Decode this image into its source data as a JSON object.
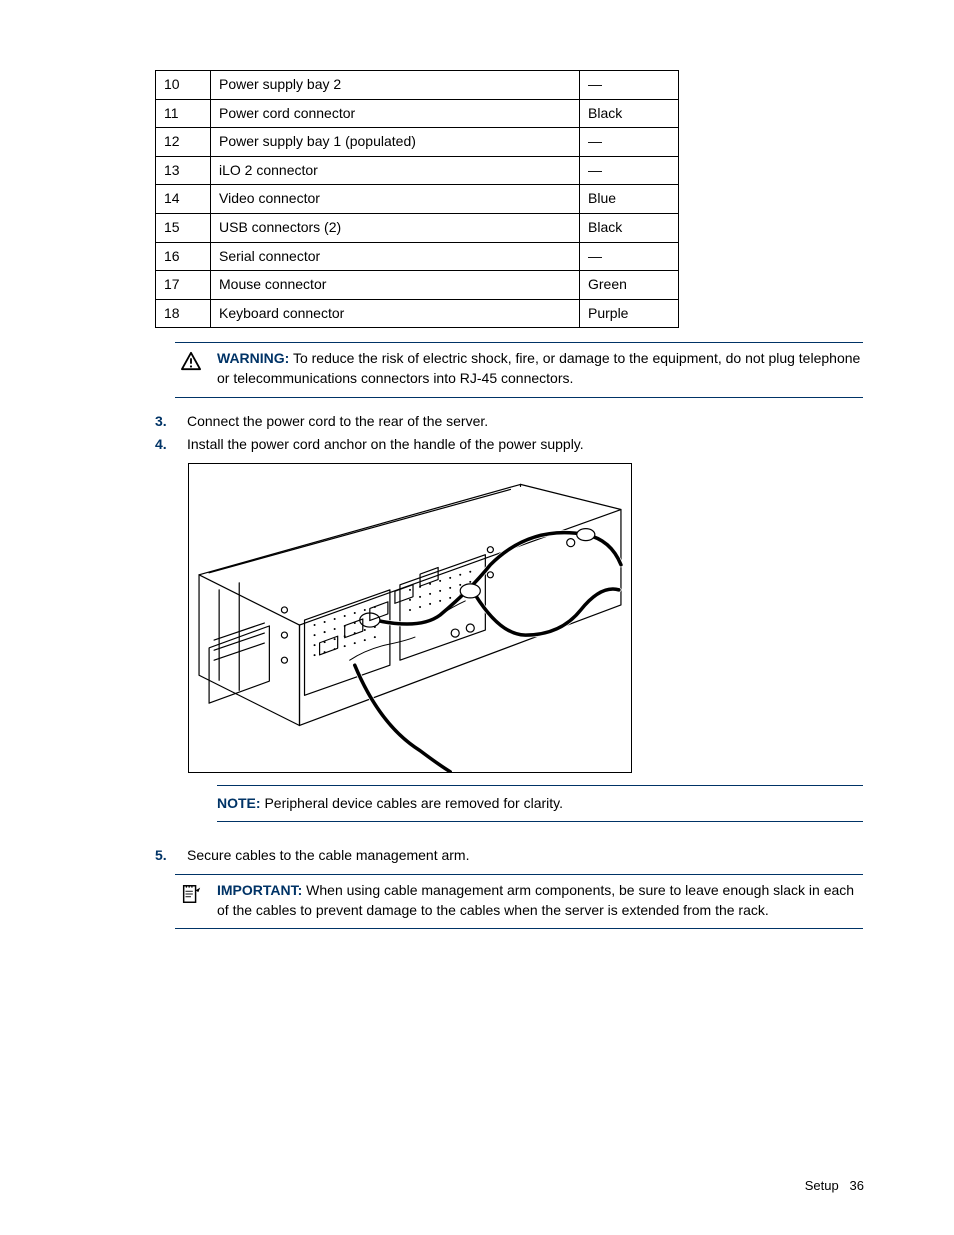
{
  "table": {
    "rows": [
      {
        "num": "10",
        "desc": "Power supply bay 2",
        "color": "—"
      },
      {
        "num": "11",
        "desc": "Power cord connector",
        "color": "Black"
      },
      {
        "num": "12",
        "desc": "Power supply bay 1 (populated)",
        "color": "—"
      },
      {
        "num": "13",
        "desc": "iLO 2 connector",
        "color": "—"
      },
      {
        "num": "14",
        "desc": "Video connector",
        "color": "Blue"
      },
      {
        "num": "15",
        "desc": "USB connectors (2)",
        "color": "Black"
      },
      {
        "num": "16",
        "desc": "Serial connector",
        "color": "—"
      },
      {
        "num": "17",
        "desc": "Mouse connector",
        "color": "Green"
      },
      {
        "num": "18",
        "desc": "Keyboard connector",
        "color": "Purple"
      }
    ]
  },
  "warning": {
    "label": "WARNING:",
    "text": "  To reduce the risk of electric shock, fire, or damage to the equipment, do not plug telephone or telecommunications connectors into RJ-45 connectors."
  },
  "steps": {
    "s3_num": "3.",
    "s3_text": "Connect the power cord to the rear of the server.",
    "s4_num": "4.",
    "s4_text": "Install the power cord anchor on the handle of the power supply.",
    "s5_num": "5.",
    "s5_text": "Secure cables to the cable management arm."
  },
  "note": {
    "label": "NOTE:",
    "text": "  Peripheral device cables are removed for clarity."
  },
  "important": {
    "label": "IMPORTANT:",
    "text": "  When using cable management arm components, be sure to leave enough slack in each of the cables to prevent damage to the cables when the server is extended from the rack."
  },
  "footer": {
    "section": "Setup",
    "page": "36"
  }
}
